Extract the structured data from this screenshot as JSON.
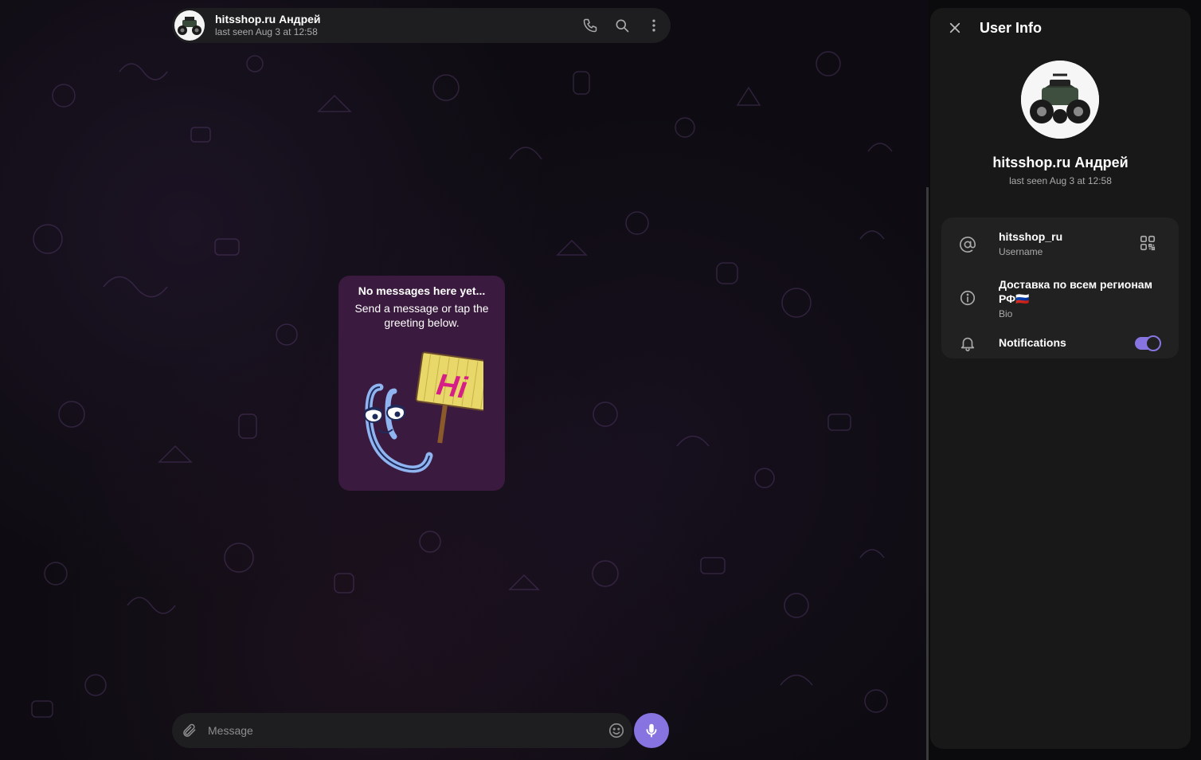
{
  "chat": {
    "name": "hitsshop.ru Андрей",
    "status": "last seen Aug 3 at 12:58"
  },
  "empty_state": {
    "title": "No messages here yet...",
    "subtitle": "Send a message or tap the greeting below.",
    "sticker_text": "Hi"
  },
  "composer": {
    "placeholder": "Message"
  },
  "user_info": {
    "title": "User Info",
    "name": "hitsshop.ru Андрей",
    "status": "last seen Aug 3 at 12:58",
    "username": "hitsshop_ru",
    "username_label": "Username",
    "bio": "Доставка по всем регионам РФ🇷🇺",
    "bio_label": "Bio",
    "notifications_label": "Notifications",
    "notifications_enabled": true
  },
  "colors": {
    "accent": "#8774e1",
    "panel": "#181818",
    "card": "#212121",
    "bubble": "#3a1a3e"
  },
  "icons": {
    "phone": "phone-icon",
    "search": "search-icon",
    "more": "more-vertical-icon",
    "attach": "paperclip-icon",
    "emoji": "emoji-icon",
    "mic": "microphone-icon",
    "close": "close-icon",
    "at": "at-sign-icon",
    "qr": "qr-code-icon",
    "info": "info-icon",
    "bell": "bell-icon"
  }
}
